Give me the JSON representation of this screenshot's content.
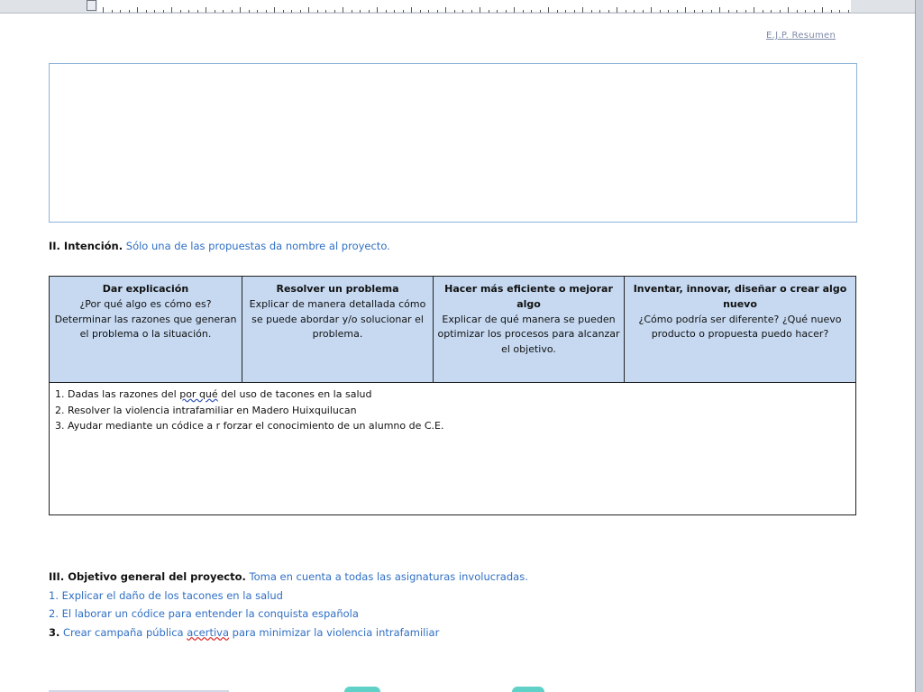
{
  "header": {
    "ref_label": "E.J.P. Resumen"
  },
  "section2": {
    "heading": "II. Intención.",
    "note": "Sólo una de las propuestas da nombre al proyecto."
  },
  "intent_table": {
    "columns": [
      {
        "title": "Dar explicación",
        "body": "¿Por qué algo es cómo es? Determinar las razones que generan el problema o la situación."
      },
      {
        "title": "Resolver un problema",
        "body": "Explicar de manera detallada cómo se puede abordar y/o solucionar el problema."
      },
      {
        "title": "Hacer más eficiente o mejorar algo",
        "body": "Explicar de qué manera se pueden optimizar los procesos para alcanzar el objetivo."
      },
      {
        "title": "Inventar, innovar, diseñar o crear algo nuevo",
        "body": "¿Cómo podría ser diferente? ¿Qué nuevo producto o propuesta puedo hacer?"
      }
    ],
    "lines": {
      "line1_a": "1. Dadas las razones del ",
      "line1_wavy": "por qué",
      "line1_b": " del uso de tacones en la salud",
      "line2": "2. Resolver la violencia intrafamiliar en Madero Huixquilucan",
      "line3": "3. Ayudar mediante un códice a r forzar el conocimiento de un alumno de C.E."
    }
  },
  "section3": {
    "heading": "III. Objetivo general del proyecto.",
    "note": "Toma en cuenta a todas las asignaturas involucradas.",
    "item1": "1. Explicar el daño de los tacones en la salud",
    "item2": "2. El laborar un códice para entender la conquista española",
    "item3_num": "3.",
    "item3_a": " Crear campaña pública ",
    "item3_wavy": "acertiva",
    "item3_b": " para minimizar la violencia intrafamiliar"
  },
  "colors": {
    "accent_blue": "#2f6fc4",
    "table_header_bg": "#c6d9f1",
    "box_border": "#8fb3d9"
  }
}
